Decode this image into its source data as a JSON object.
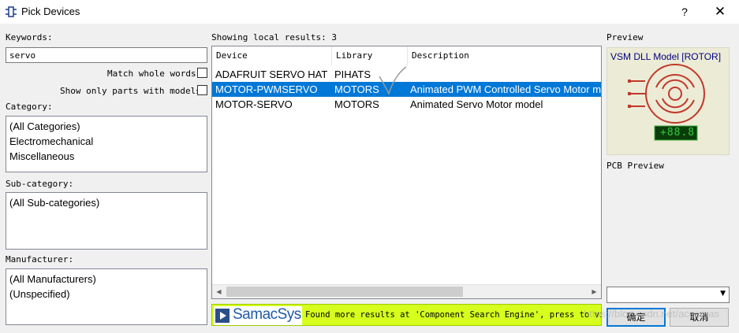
{
  "window": {
    "title": "Pick Devices",
    "help_label": "?",
    "close_label": "✕"
  },
  "keywords": {
    "label": "Keywords:",
    "value": "servo",
    "match_whole_label": "Match whole words?",
    "show_models_label": "Show only parts with models?"
  },
  "category": {
    "label": "Category:",
    "items": [
      "(All Categories)",
      "Electromechanical",
      "Miscellaneous"
    ]
  },
  "subcategory": {
    "label": "Sub-category:",
    "items": [
      "(All Sub-categories)"
    ]
  },
  "manufacturer": {
    "label": "Manufacturer:",
    "items": [
      "(All Manufacturers)",
      "(Unspecified)"
    ]
  },
  "results": {
    "summary": "Showing local results: 3",
    "columns": [
      "Device",
      "Library",
      "Description"
    ],
    "rows": [
      {
        "device": "ADAFRUIT SERVO HAT",
        "library": "PIHATS",
        "description": ""
      },
      {
        "device": "MOTOR-PWMSERVO",
        "library": "MOTORS",
        "description": "Animated PWM Controlled Servo Motor m"
      },
      {
        "device": "MOTOR-SERVO",
        "library": "MOTORS",
        "description": "Animated Servo Motor model"
      }
    ],
    "selected_index": 1
  },
  "banner": {
    "brand": "SamacSys",
    "text": "Found more results at 'Component Search Engine', press to view"
  },
  "preview": {
    "label": "Preview",
    "model_title": "VSM DLL Model [ROTOR]",
    "counter": "+88.8",
    "pcb_label": "PCB Preview"
  },
  "buttons": {
    "ok": "确定",
    "cancel": "取消"
  },
  "watermark": "https://blog.csdn.net/acecmas",
  "colors": {
    "selection": "#0078d7",
    "banner": "#d6ff1e",
    "preview_bg": "#ecebd6",
    "component": "#c0392b"
  }
}
